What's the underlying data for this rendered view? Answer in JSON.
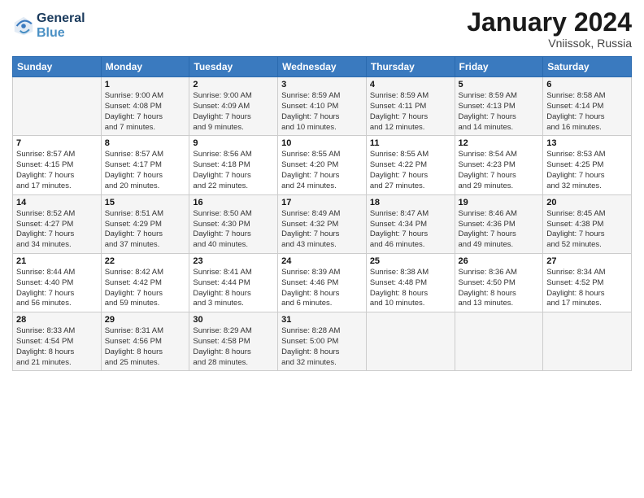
{
  "header": {
    "logo_line1": "General",
    "logo_line2": "Blue",
    "month_title": "January 2024",
    "subtitle": "Vniissok, Russia"
  },
  "weekdays": [
    "Sunday",
    "Monday",
    "Tuesday",
    "Wednesday",
    "Thursday",
    "Friday",
    "Saturday"
  ],
  "weeks": [
    [
      {
        "day": "",
        "info": ""
      },
      {
        "day": "1",
        "info": "Sunrise: 9:00 AM\nSunset: 4:08 PM\nDaylight: 7 hours\nand 7 minutes."
      },
      {
        "day": "2",
        "info": "Sunrise: 9:00 AM\nSunset: 4:09 AM\nDaylight: 7 hours\nand 9 minutes."
      },
      {
        "day": "3",
        "info": "Sunrise: 8:59 AM\nSunset: 4:10 PM\nDaylight: 7 hours\nand 10 minutes."
      },
      {
        "day": "4",
        "info": "Sunrise: 8:59 AM\nSunset: 4:11 PM\nDaylight: 7 hours\nand 12 minutes."
      },
      {
        "day": "5",
        "info": "Sunrise: 8:59 AM\nSunset: 4:13 PM\nDaylight: 7 hours\nand 14 minutes."
      },
      {
        "day": "6",
        "info": "Sunrise: 8:58 AM\nSunset: 4:14 PM\nDaylight: 7 hours\nand 16 minutes."
      }
    ],
    [
      {
        "day": "7",
        "info": "Sunrise: 8:57 AM\nSunset: 4:15 PM\nDaylight: 7 hours\nand 17 minutes."
      },
      {
        "day": "8",
        "info": "Sunrise: 8:57 AM\nSunset: 4:17 PM\nDaylight: 7 hours\nand 20 minutes."
      },
      {
        "day": "9",
        "info": "Sunrise: 8:56 AM\nSunset: 4:18 PM\nDaylight: 7 hours\nand 22 minutes."
      },
      {
        "day": "10",
        "info": "Sunrise: 8:55 AM\nSunset: 4:20 PM\nDaylight: 7 hours\nand 24 minutes."
      },
      {
        "day": "11",
        "info": "Sunrise: 8:55 AM\nSunset: 4:22 PM\nDaylight: 7 hours\nand 27 minutes."
      },
      {
        "day": "12",
        "info": "Sunrise: 8:54 AM\nSunset: 4:23 PM\nDaylight: 7 hours\nand 29 minutes."
      },
      {
        "day": "13",
        "info": "Sunrise: 8:53 AM\nSunset: 4:25 PM\nDaylight: 7 hours\nand 32 minutes."
      }
    ],
    [
      {
        "day": "14",
        "info": "Sunrise: 8:52 AM\nSunset: 4:27 PM\nDaylight: 7 hours\nand 34 minutes."
      },
      {
        "day": "15",
        "info": "Sunrise: 8:51 AM\nSunset: 4:29 PM\nDaylight: 7 hours\nand 37 minutes."
      },
      {
        "day": "16",
        "info": "Sunrise: 8:50 AM\nSunset: 4:30 PM\nDaylight: 7 hours\nand 40 minutes."
      },
      {
        "day": "17",
        "info": "Sunrise: 8:49 AM\nSunset: 4:32 PM\nDaylight: 7 hours\nand 43 minutes."
      },
      {
        "day": "18",
        "info": "Sunrise: 8:47 AM\nSunset: 4:34 PM\nDaylight: 7 hours\nand 46 minutes."
      },
      {
        "day": "19",
        "info": "Sunrise: 8:46 AM\nSunset: 4:36 PM\nDaylight: 7 hours\nand 49 minutes."
      },
      {
        "day": "20",
        "info": "Sunrise: 8:45 AM\nSunset: 4:38 PM\nDaylight: 7 hours\nand 52 minutes."
      }
    ],
    [
      {
        "day": "21",
        "info": "Sunrise: 8:44 AM\nSunset: 4:40 PM\nDaylight: 7 hours\nand 56 minutes."
      },
      {
        "day": "22",
        "info": "Sunrise: 8:42 AM\nSunset: 4:42 PM\nDaylight: 7 hours\nand 59 minutes."
      },
      {
        "day": "23",
        "info": "Sunrise: 8:41 AM\nSunset: 4:44 PM\nDaylight: 8 hours\nand 3 minutes."
      },
      {
        "day": "24",
        "info": "Sunrise: 8:39 AM\nSunset: 4:46 PM\nDaylight: 8 hours\nand 6 minutes."
      },
      {
        "day": "25",
        "info": "Sunrise: 8:38 AM\nSunset: 4:48 PM\nDaylight: 8 hours\nand 10 minutes."
      },
      {
        "day": "26",
        "info": "Sunrise: 8:36 AM\nSunset: 4:50 PM\nDaylight: 8 hours\nand 13 minutes."
      },
      {
        "day": "27",
        "info": "Sunrise: 8:34 AM\nSunset: 4:52 PM\nDaylight: 8 hours\nand 17 minutes."
      }
    ],
    [
      {
        "day": "28",
        "info": "Sunrise: 8:33 AM\nSunset: 4:54 PM\nDaylight: 8 hours\nand 21 minutes."
      },
      {
        "day": "29",
        "info": "Sunrise: 8:31 AM\nSunset: 4:56 PM\nDaylight: 8 hours\nand 25 minutes."
      },
      {
        "day": "30",
        "info": "Sunrise: 8:29 AM\nSunset: 4:58 PM\nDaylight: 8 hours\nand 28 minutes."
      },
      {
        "day": "31",
        "info": "Sunrise: 8:28 AM\nSunset: 5:00 PM\nDaylight: 8 hours\nand 32 minutes."
      },
      {
        "day": "",
        "info": ""
      },
      {
        "day": "",
        "info": ""
      },
      {
        "day": "",
        "info": ""
      }
    ]
  ]
}
